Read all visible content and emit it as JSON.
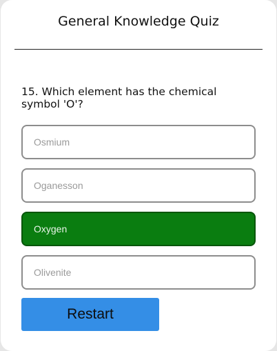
{
  "quiz": {
    "title": "General Knowledge Quiz",
    "question": "15. Which element has the chemical symbol 'O'?",
    "options": [
      {
        "label": "Osmium",
        "state": "default"
      },
      {
        "label": "Oganesson",
        "state": "default"
      },
      {
        "label": "Oxygen",
        "state": "correct"
      },
      {
        "label": "Olivenite",
        "state": "default"
      }
    ],
    "restart_label": "Restart"
  },
  "colors": {
    "correct_fill": "#0a7d10",
    "button_blue": "#348ee6",
    "option_border": "#8c8c8c"
  }
}
